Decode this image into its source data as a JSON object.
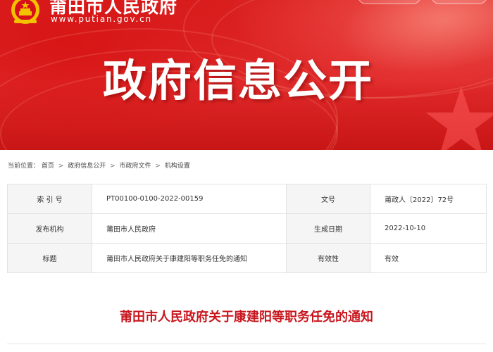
{
  "header": {
    "site_name": "莆田市人民政府",
    "site_domain": "www.putian.gov.cn",
    "banner_title": "政府信息公开"
  },
  "breadcrumb": {
    "prefix": "当前位置：",
    "items": [
      "首页",
      "政府信息公开",
      "市政府文件",
      "机构设置"
    ],
    "separator": ">"
  },
  "info": {
    "row1": {
      "label_a": "索 引 号",
      "value_a": "PT00100-0100-2022-00159",
      "label_b": "文号",
      "value_b": "莆政人〔2022〕72号"
    },
    "row2": {
      "label_a": "发布机构",
      "value_a": "莆田市人民政府",
      "label_b": "生成日期",
      "value_b": "2022-10-10"
    },
    "row3": {
      "label_a": "标题",
      "value_a": "莆田市人民政府关于康建阳等职务任免的通知",
      "label_b": "有效性",
      "value_b": "有效"
    }
  },
  "article": {
    "title": "莆田市人民政府关于康建阳等职务任免的通知"
  },
  "colors": {
    "banner_red": "#d91f1f",
    "title_red": "#c8161d",
    "label_bg": "#f5f5f5",
    "border": "#e2e2e2"
  },
  "icons": {
    "emblem": "national-emblem-icon",
    "star": "star-icon"
  }
}
